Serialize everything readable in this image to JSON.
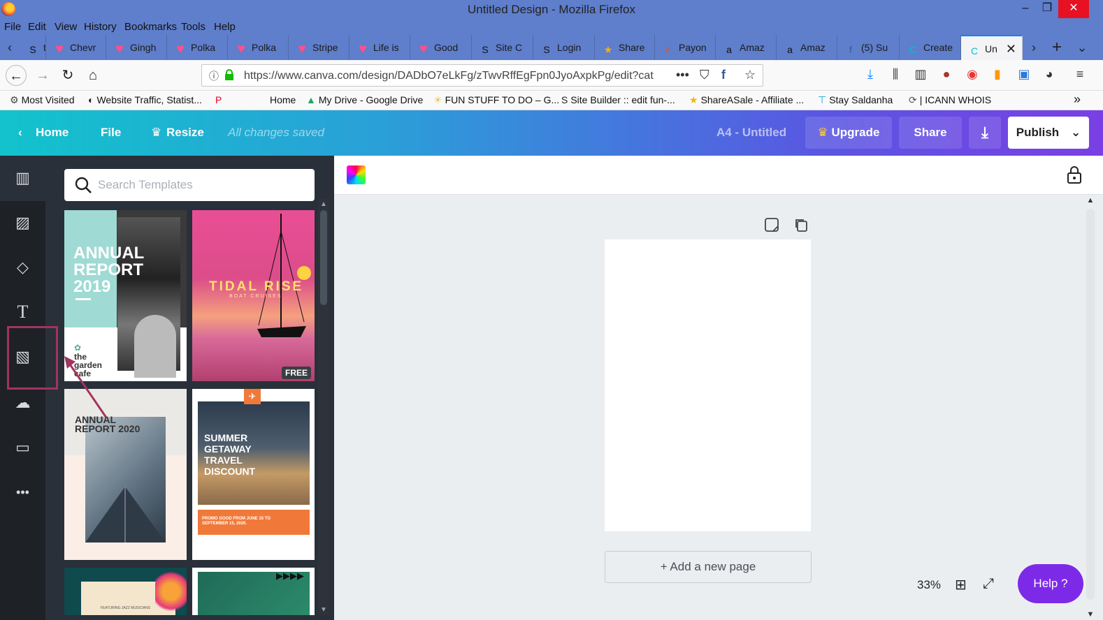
{
  "window": {
    "title": "Untitled Design - Mozilla Firefox",
    "minimize": "–",
    "restore": "❐",
    "close": "✕"
  },
  "menu": [
    "File",
    "Edit",
    "View",
    "History",
    "Bookmarks",
    "Tools",
    "Help"
  ],
  "tabs": [
    {
      "label": "tal E",
      "icon": "site-icon",
      "glyph": "S"
    },
    {
      "label": "Chevr",
      "icon": "heart-icon",
      "glyph": "♥"
    },
    {
      "label": "Gingh",
      "icon": "heart-icon",
      "glyph": "♥"
    },
    {
      "label": "Polka",
      "icon": "heart-icon",
      "glyph": "♥"
    },
    {
      "label": "Polka",
      "icon": "heart-icon",
      "glyph": "♥"
    },
    {
      "label": "Stripe",
      "icon": "heart-icon",
      "glyph": "♥"
    },
    {
      "label": "Life is",
      "icon": "heart-icon",
      "glyph": "♥"
    },
    {
      "label": "Good",
      "icon": "heart-icon",
      "glyph": "♥"
    },
    {
      "label": "Site C",
      "icon": "site-builder-icon",
      "glyph": "S"
    },
    {
      "label": "Login",
      "icon": "site-builder-icon",
      "glyph": "S"
    },
    {
      "label": "Share",
      "icon": "star-icon",
      "glyph": "★"
    },
    {
      "label": "Payon",
      "icon": "payoneer-icon",
      "glyph": "✓"
    },
    {
      "label": "Amaz",
      "icon": "amazon-icon",
      "glyph": "a"
    },
    {
      "label": "Amaz",
      "icon": "amazon-icon",
      "glyph": "a"
    },
    {
      "label": "(5) Su",
      "icon": "facebook-icon",
      "glyph": "f"
    },
    {
      "label": "Create",
      "icon": "canva-icon",
      "glyph": "C"
    },
    {
      "label": "Un",
      "icon": "canva-icon",
      "glyph": "C",
      "active": true
    }
  ],
  "nav": {
    "url": "https://www.canva.com/design/DADbO7eLkFg/zTwvRffEgFpn0JyoAxpkPg/edit?cat"
  },
  "bookmarks": [
    {
      "label": "Most Visited",
      "icon": "gear-icon",
      "glyph": "⚙"
    },
    {
      "label": "Website Traffic, Statist...",
      "icon": "similarweb-icon",
      "glyph": "◐"
    },
    {
      "label": "",
      "icon": "pinterest-icon",
      "glyph": "P"
    },
    {
      "label": "Home",
      "icon": "",
      "glyph": ""
    },
    {
      "label": "My Drive - Google Drive",
      "icon": "google-drive-icon",
      "glyph": "▲"
    },
    {
      "label": "FUN STUFF TO DO – G...",
      "icon": "sun-icon",
      "glyph": "☀"
    },
    {
      "label": "Site Builder :: edit fun-...",
      "icon": "site-builder-icon",
      "glyph": "S"
    },
    {
      "label": "ShareASale - Affiliate ...",
      "icon": "star-icon",
      "glyph": "★"
    },
    {
      "label": "Stay Saldanha",
      "icon": "pin-icon",
      "glyph": "⊤"
    },
    {
      "label": "| ICANN WHOIS",
      "icon": "icann-icon",
      "glyph": "⟳"
    }
  ],
  "canva_header": {
    "home": "Home",
    "file": "File",
    "resize": "Resize",
    "saved": "All changes saved",
    "doc_name": "A4 - Untitled",
    "upgrade": "Upgrade",
    "share": "Share",
    "publish": "Publish"
  },
  "search": {
    "placeholder": "Search Templates"
  },
  "templates": [
    {
      "title": "ANNUAL REPORT 2019",
      "sub": "the garden cafe"
    },
    {
      "title": "TIDAL RISE",
      "sub": "BOAT CRUISES",
      "badge": "FREE"
    },
    {
      "title": "ANNUAL REPORT 2020",
      "sub": ""
    },
    {
      "title": "SUMMER GETAWAY TRAVEL DISCOUNT",
      "sub": "PROMO GOOD FROM JUNE 15 TO SEPTEMBER 15, 2020."
    },
    {
      "title": "FEATURING JAZZ MUSICIANS",
      "sub": ""
    },
    {
      "title": "",
      "sub": ""
    }
  ],
  "editor": {
    "add_page": "+ Add a new page",
    "zoom": "33%",
    "help": "Help ?"
  }
}
